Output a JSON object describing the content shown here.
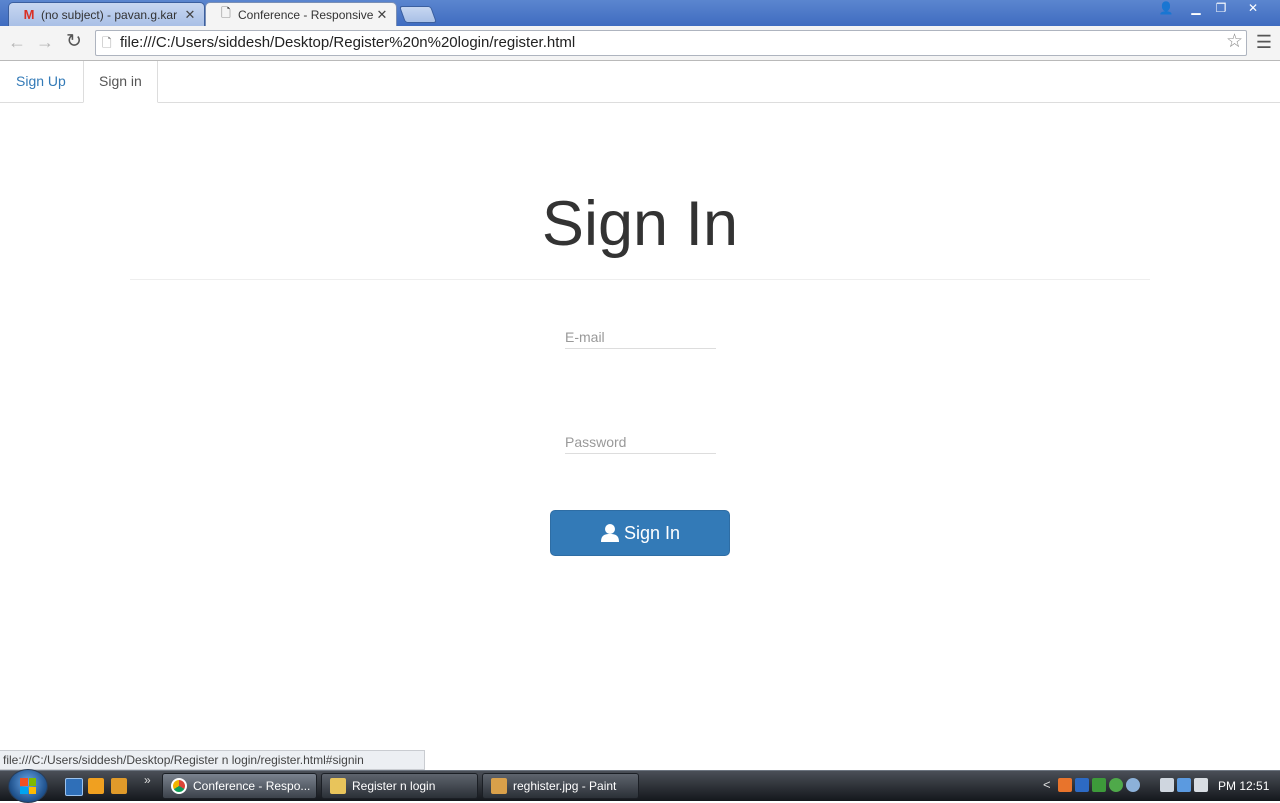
{
  "browser": {
    "tabs": [
      {
        "title": "(no subject) - pavan.g.kar",
        "favicon": "gmail-icon",
        "active": false
      },
      {
        "title": "Conference - Responsive",
        "favicon": "page-icon",
        "active": true
      }
    ],
    "address_bar": {
      "url": "file:///C:/Users/siddesh/Desktop/Register%20n%20login/register.html"
    },
    "status_bar": "file:///C:/Users/siddesh/Desktop/Register n login/register.html#signin"
  },
  "page": {
    "nav_tabs": [
      {
        "label": "Sign Up",
        "active": false
      },
      {
        "label": "Sign in",
        "active": true
      }
    ],
    "heading": "Sign In",
    "email_field": {
      "placeholder": "E-mail",
      "value": ""
    },
    "password_field": {
      "placeholder": "Password",
      "value": ""
    },
    "submit_button": {
      "label": "Sign In",
      "icon": "user-icon"
    }
  },
  "taskbar": {
    "tasks": [
      {
        "label": "Conference - Respo...",
        "icon": "chrome-icon"
      },
      {
        "label": "Register n login",
        "icon": "folder-icon"
      },
      {
        "label": "reghister.jpg - Paint",
        "icon": "paint-icon"
      }
    ],
    "clock": "PM 12:51"
  },
  "colors": {
    "primary_button": "#337ab7",
    "link": "#337ab7",
    "titlebar": "#4b78c8",
    "taskbar": "#1e2228"
  }
}
